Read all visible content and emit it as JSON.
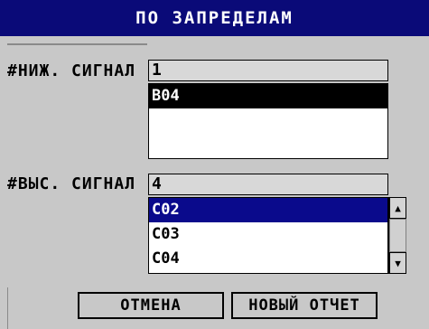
{
  "title": "ПО ЗАПРЕДЕЛАМ",
  "low_alarm": {
    "label": "#НИЖ. СИГНАЛ",
    "value": "1",
    "items": [
      "B04"
    ]
  },
  "high_alarm": {
    "label": "#ВЫС. СИГНАЛ",
    "value": "4",
    "items": [
      "C02",
      "C03",
      "C04"
    ]
  },
  "buttons": {
    "cancel": "ОТМЕНА",
    "new_report": "НОВЫЙ ОТЧЕТ"
  },
  "icons": {
    "scroll_up": "up-arrow",
    "scroll_down": "down-arrow"
  }
}
